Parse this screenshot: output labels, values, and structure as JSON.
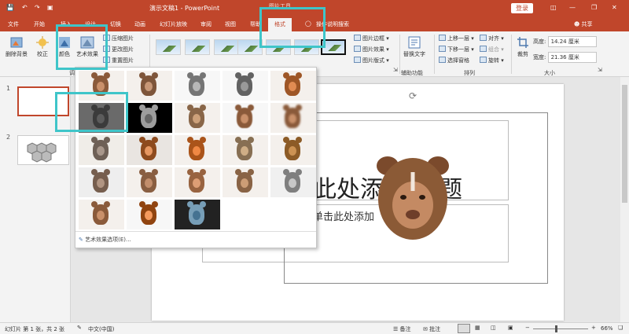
{
  "titlebar": {
    "doc_title": "演示文稿1 - PowerPoint",
    "picture_tools": "图片工具",
    "login_button": "登录",
    "share": "共享"
  },
  "tabs": [
    "文件",
    "开始",
    "插入",
    "设计",
    "切换",
    "动画",
    "幻灯片放映",
    "审阅",
    "视图",
    "帮助",
    "格式"
  ],
  "tell_me": "操作说明搜索",
  "ribbon": {
    "remove_bg": "删除背景",
    "corrections": "校正",
    "color": "颜色",
    "artistic": "艺术效果",
    "compress": "压缩图片",
    "change_pic": "更改图片",
    "reset_pic": "重置图片",
    "pic_border": "图片边框",
    "pic_effects": "图片效果",
    "pic_layout": "图片版式",
    "alt_text": "替换文字",
    "accessibility": "辅助功能",
    "bring_forward": "上移一层",
    "send_backward": "下移一层",
    "selection_pane": "选择窗格",
    "align": "对齐",
    "group": "组合",
    "rotate": "旋转",
    "arrange": "排列",
    "crop": "裁剪",
    "height_label": "高度:",
    "height_value": "14.24 厘米",
    "width_label": "宽度:",
    "width_value": "21.36 厘米",
    "size": "大小",
    "adjust_partial": "调"
  },
  "slides": [
    "1",
    "2"
  ],
  "slide": {
    "title_fragment_a": "此处添",
    "title_fragment_b": "题",
    "subtitle_fragment": "单击此处添加"
  },
  "gallery": {
    "options_label": "艺术效果选项(E)..."
  },
  "statusbar": {
    "slide_info": "幻灯片 第 1 张，共 2 张",
    "language": "中文(中国)",
    "notes": "备注",
    "comments": "批注",
    "zoom": "66%"
  },
  "colors": {
    "accent": "#c0462b",
    "highlight": "#3fc5c9"
  }
}
